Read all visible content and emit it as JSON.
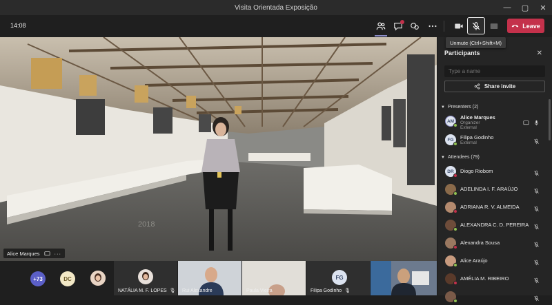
{
  "window": {
    "title": "Visita Orientada Exposição"
  },
  "toolbar": {
    "clock": "14:08",
    "leave_label": "Leave",
    "tooltip": "Unmute (Ctrl+Shift+M)"
  },
  "stage": {
    "speaker_name": "Alice Marques",
    "overlay_text": "2018"
  },
  "strip": {
    "overflow_count": "+73",
    "dc_initials": "DC",
    "tiles": [
      {
        "label": "NATÁLIA M. F. LOPES"
      },
      {
        "label": "Rui Alexandre"
      },
      {
        "label": "Paula Vieira"
      },
      {
        "label": "Filipa Godinho",
        "initials": "FG"
      },
      {
        "label": ""
      }
    ]
  },
  "panel": {
    "title": "Participants",
    "search_placeholder": "Type a name",
    "share_label": "Share invite",
    "presenters_header": "Presenters (2)",
    "attendees_header": "Attendees (79)",
    "presenters": [
      {
        "initials": "AM",
        "name": "Alice Marques",
        "role": "Organizer",
        "sub": "External"
      },
      {
        "initials": "FG",
        "name": "Filipa Godinho",
        "sub": "External"
      }
    ],
    "attendees": [
      {
        "initials": "DR",
        "name": "Diogo Riobom"
      },
      {
        "initials": "",
        "name": "ADELINDA I. F. ARAÚJO"
      },
      {
        "initials": "",
        "name": "ADRIANA R. V. ALMEIDA"
      },
      {
        "initials": "",
        "name": "ALEXANDRA C. D. PEREIRA"
      },
      {
        "initials": "",
        "name": "Alexandra Sousa"
      },
      {
        "initials": "",
        "name": "Alice Araújo"
      },
      {
        "initials": "",
        "name": "AMÉLIA M. RIBEIRO"
      },
      {
        "initials": "",
        "name": ""
      }
    ]
  },
  "colors": {
    "leave": "#c4314b",
    "accent": "#6264a7",
    "panel_bg": "#252525"
  }
}
